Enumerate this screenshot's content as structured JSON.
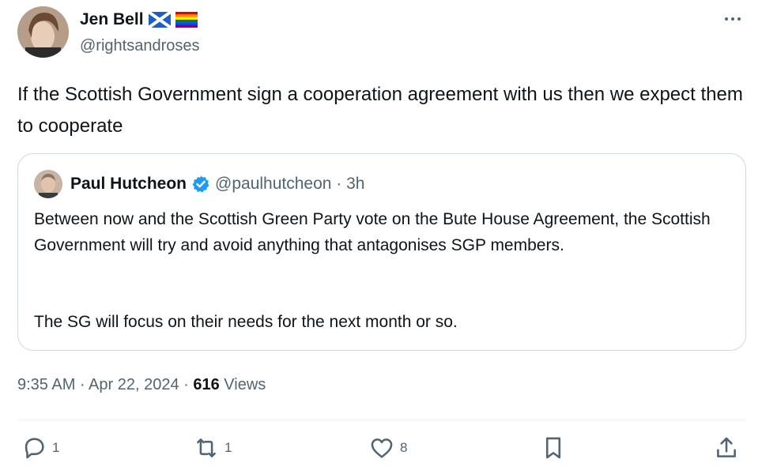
{
  "author": {
    "display_name": "Jen Bell",
    "handle": "@rightsandroses"
  },
  "tweet": {
    "text": "If the Scottish Government sign a cooperation agreement with us then we expect them to cooperate"
  },
  "quoted": {
    "display_name": "Paul Hutcheon",
    "handle_time": "@paulhutcheon · 3h",
    "paragraph1": "Between now and the Scottish Green Party vote on the Bute House Agreement, the Scottish Government will try and avoid anything that antagonises SGP members.",
    "paragraph2": "The SG will focus on their needs for the next month or so."
  },
  "meta": {
    "time_date": "9:35 AM · Apr 22, 2024 · ",
    "views_count": "616",
    "views_label": " Views"
  },
  "actions": {
    "replies": "1",
    "reposts": "1",
    "likes": "8"
  },
  "icons": [
    "more-icon",
    "scotland-flag-icon",
    "rainbow-flag-icon",
    "verified-badge-icon",
    "reply-icon",
    "repost-icon",
    "like-icon",
    "bookmark-icon",
    "share-icon"
  ],
  "colors": {
    "text_primary": "#0f1419",
    "text_secondary": "#536471",
    "verified_blue": "#1d9bf0",
    "border": "#cfd9de"
  }
}
